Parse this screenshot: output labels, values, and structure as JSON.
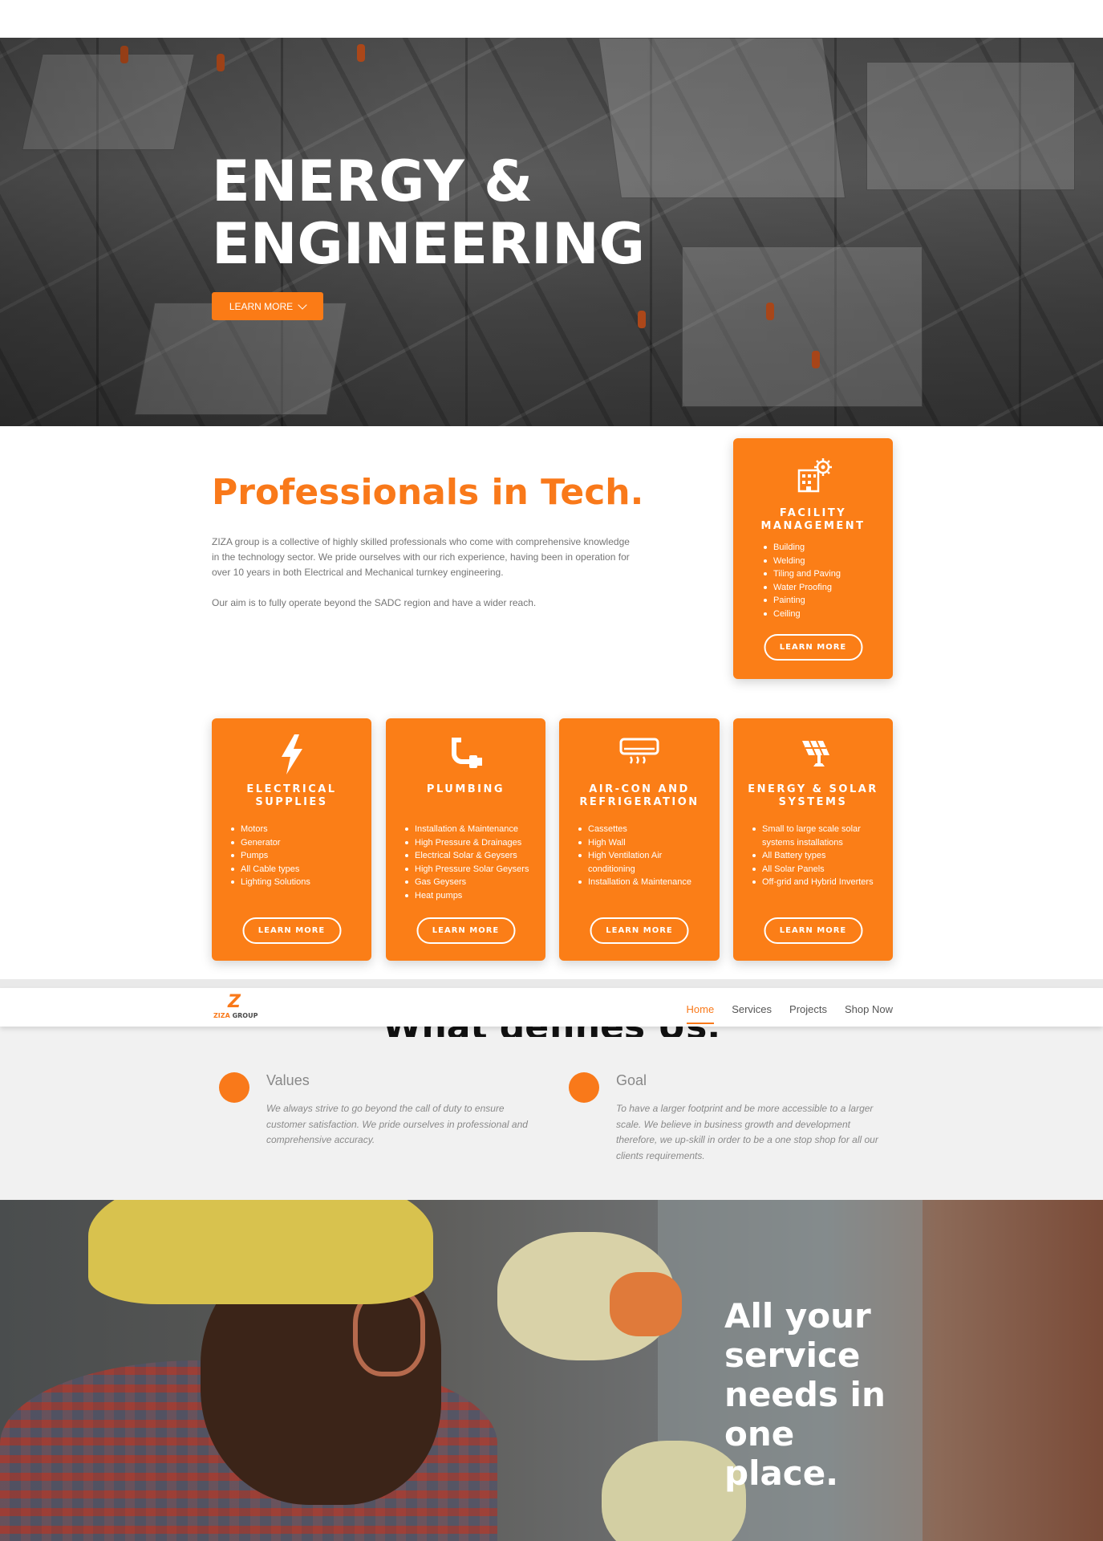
{
  "hero": {
    "title_line1": "ENERGY &",
    "title_line2": "ENGINEERING",
    "button_label": "LEARN MORE"
  },
  "intro": {
    "title": "Professionals in Tech.",
    "paragraph1": "ZIZA group is a collective of highly skilled professionals who come with comprehensive knowledge in the technology sector. We pride ourselves with our rich experience, having been in operation for over 10 years in both Electrical and Mechanical turnkey engineering.",
    "paragraph2": "Our aim is to fully operate beyond the SADC region and have a wider reach."
  },
  "cards": {
    "facility": {
      "icon": "building-gear-icon",
      "title": "FACILITY MANAGEMENT",
      "items": [
        "Building",
        "Welding",
        "Tiling and Paving",
        "Water Proofing",
        "Painting",
        " Ceiling"
      ],
      "button": "LEARN MORE"
    },
    "electrical": {
      "icon": "lightning-icon",
      "title": "ELECTRICAL SUPPLIES",
      "items": [
        "Motors",
        "Generator",
        "Pumps",
        "All Cable types",
        "Lighting Solutions"
      ],
      "button": "LEARN MORE"
    },
    "plumbing": {
      "icon": "pipe-faucet-icon",
      "title": "PLUMBING",
      "items": [
        "Installation & Maintenance",
        "High Pressure & Drainages",
        "Electrical Solar & Geysers",
        "High Pressure Solar Geysers",
        "Gas Geysers",
        "Heat pumps"
      ],
      "button": "LEARN MORE"
    },
    "aircon": {
      "icon": "air-conditioner-icon",
      "title": "AIR-CON AND REFRIGERATION",
      "items": [
        "Cassettes",
        "High Wall",
        "High Ventilation Air conditioning",
        "Installation & Maintenance"
      ],
      "button": "LEARN MORE"
    },
    "solar": {
      "icon": "solar-panel-icon",
      "title": "ENERGY & SOLAR SYSTEMS",
      "items": [
        "Small to large scale solar systems installations",
        "All Battery  types",
        "All Solar Panels",
        "Off-grid and Hybrid Inverters"
      ],
      "button": "LEARN MORE"
    }
  },
  "navbar": {
    "logo_text_part1": "ZIZA",
    "logo_text_part2": " GROUP",
    "links": [
      "Home",
      "Services",
      "Projects",
      "Shop Now"
    ],
    "active": "Home"
  },
  "defines": {
    "heading": "What defines Us.",
    "values": {
      "title": "Values",
      "text": "We always strive to go beyond the call of duty to ensure customer satisfaction. We pride ourselves in professional and comprehensive accuracy."
    },
    "goal": {
      "title": "Goal",
      "text": "To have a larger footprint and be more accessible to a larger scale. We believe in business growth and development therefore, we up-skill in order to be a one stop shop for all our clients requirements."
    }
  },
  "bottom": {
    "slogan": "All your service needs in one place."
  },
  "colors": {
    "accent": "#f9791a",
    "card_bg": "#fb7e17",
    "band_bg": "#f1f1f1"
  }
}
